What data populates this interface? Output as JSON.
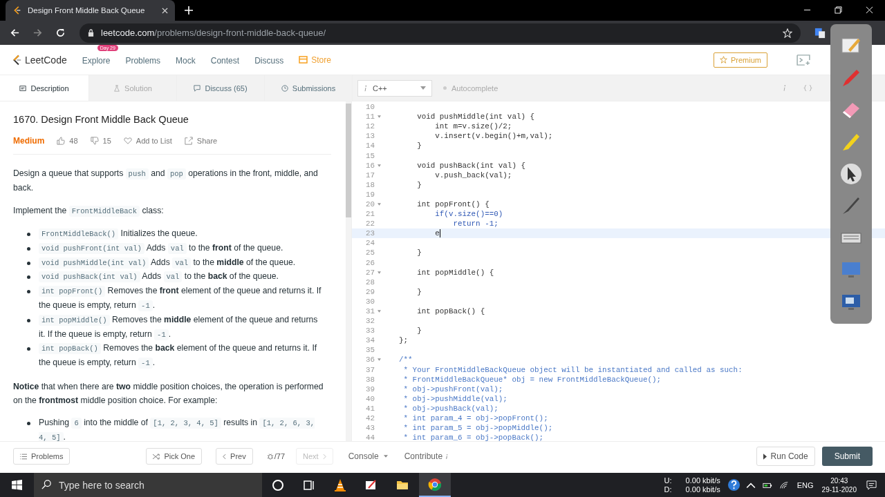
{
  "browser": {
    "tab_title": "Design Front Middle Back Queue",
    "url_host": "leetcode.com",
    "url_path": "/problems/design-front-middle-back-queue/"
  },
  "nav": {
    "logo": "LeetCode",
    "premium": "Premium",
    "items": [
      {
        "label": "Explore",
        "kind": "badge",
        "badge": "Day 29"
      },
      {
        "label": "Problems",
        "kind": "plain"
      },
      {
        "label": "Mock",
        "kind": "plain"
      },
      {
        "label": "Contest",
        "kind": "plain"
      },
      {
        "label": "Discuss",
        "kind": "plain"
      },
      {
        "label": "Store",
        "kind": "store"
      }
    ]
  },
  "panel_tabs": [
    {
      "label": "Description",
      "selected": true,
      "disabled": false
    },
    {
      "label": "Solution",
      "selected": false,
      "disabled": true
    },
    {
      "label": "Discuss (65)",
      "selected": false,
      "disabled": false
    },
    {
      "label": "Submissions",
      "selected": false,
      "disabled": false
    }
  ],
  "editor_toolbar": {
    "language": "C++",
    "autocomplete": "Autocomplete"
  },
  "problem": {
    "title": "1670. Design Front Middle Back Queue",
    "difficulty": "Medium",
    "likes": "48",
    "dislikes": "15",
    "add_to_list": "Add to List",
    "share": "Share",
    "blocks": [
      {
        "kind": "para",
        "segments": [
          {
            "kind": "text",
            "text": "Design a queue that supports "
          },
          {
            "kind": "code",
            "text": "push"
          },
          {
            "kind": "text",
            "text": " and "
          },
          {
            "kind": "code",
            "text": "pop"
          },
          {
            "kind": "text",
            "text": " operations in the front, middle, and back."
          }
        ]
      },
      {
        "kind": "para",
        "segments": [
          {
            "kind": "text",
            "text": "Implement the "
          },
          {
            "kind": "code",
            "text": "FrontMiddleBack"
          },
          {
            "kind": "text",
            "text": " class:"
          }
        ]
      },
      {
        "kind": "list",
        "items": [
          [
            {
              "kind": "code",
              "text": "FrontMiddleBack()"
            },
            {
              "kind": "text",
              "text": " Initializes the queue."
            }
          ],
          [
            {
              "kind": "code",
              "text": "void pushFront(int val)"
            },
            {
              "kind": "text",
              "text": " Adds "
            },
            {
              "kind": "code",
              "text": "val"
            },
            {
              "kind": "text",
              "text": " to the **front** of the queue."
            }
          ],
          [
            {
              "kind": "code",
              "text": "void pushMiddle(int val)"
            },
            {
              "kind": "text",
              "text": " Adds "
            },
            {
              "kind": "code",
              "text": "val"
            },
            {
              "kind": "text",
              "text": " to the **middle** of the queue."
            }
          ],
          [
            {
              "kind": "code",
              "text": "void pushBack(int val)"
            },
            {
              "kind": "text",
              "text": " Adds "
            },
            {
              "kind": "code",
              "text": "val"
            },
            {
              "kind": "text",
              "text": " to the **back** of the queue."
            }
          ],
          [
            {
              "kind": "code",
              "text": "int popFront()"
            },
            {
              "kind": "text",
              "text": " Removes the **front** element of the queue and returns it. If the queue is empty, return "
            },
            {
              "kind": "code",
              "text": "-1"
            },
            {
              "kind": "text",
              "text": "."
            }
          ],
          [
            {
              "kind": "code",
              "text": "int popMiddle()"
            },
            {
              "kind": "text",
              "text": " Removes the **middle** element of the queue and returns it. If the queue is empty, return "
            },
            {
              "kind": "code",
              "text": "-1"
            },
            {
              "kind": "text",
              "text": "."
            }
          ],
          [
            {
              "kind": "code",
              "text": "int popBack()"
            },
            {
              "kind": "text",
              "text": " Removes the **back** element of the queue and returns it. If the queue is empty, return "
            },
            {
              "kind": "code",
              "text": "-1"
            },
            {
              "kind": "text",
              "text": "."
            }
          ]
        ]
      },
      {
        "kind": "para",
        "segments": [
          {
            "kind": "text",
            "text": "**Notice** that when there are **two** middle position choices, the operation is performed on the **frontmost** middle position choice. For example:"
          }
        ]
      },
      {
        "kind": "list",
        "items": [
          [
            {
              "kind": "text",
              "text": "Pushing "
            },
            {
              "kind": "code",
              "text": "6"
            },
            {
              "kind": "text",
              "text": " into the middle of "
            },
            {
              "kind": "code",
              "text": "[1, 2, 3, 4, 5]"
            },
            {
              "kind": "text",
              "text": " results in "
            },
            {
              "kind": "code",
              "text": "[1, 2, 6, 3, 4, 5]"
            },
            {
              "kind": "text",
              "text": "."
            }
          ]
        ]
      }
    ]
  },
  "code_lines": [
    {
      "num": "10",
      "kind": "code",
      "fold": false,
      "active": false
    },
    {
      "num": "11",
      "text": "    void pushMiddle(int val) {",
      "kind": "code",
      "fold": true,
      "active": false
    },
    {
      "num": "12",
      "text": "        int m=v.size()/2;",
      "kind": "code",
      "fold": false,
      "active": false
    },
    {
      "num": "13",
      "text": "        v.insert(v.begin()+m,val);",
      "kind": "code",
      "fold": false,
      "active": false
    },
    {
      "num": "14",
      "text": "    }",
      "kind": "code",
      "fold": false,
      "active": false
    },
    {
      "num": "15",
      "kind": "code",
      "fold": false,
      "active": false
    },
    {
      "num": "16",
      "text": "    void pushBack(int val) {",
      "kind": "code",
      "fold": true,
      "active": false
    },
    {
      "num": "17",
      "text": "        v.push_back(val);",
      "kind": "code",
      "fold": false,
      "active": false
    },
    {
      "num": "18",
      "text": "    }",
      "kind": "code",
      "fold": false,
      "active": false
    },
    {
      "num": "19",
      "kind": "code",
      "fold": false,
      "active": false
    },
    {
      "num": "20",
      "text": "    int popFront() {",
      "kind": "code",
      "fold": true,
      "active": false
    },
    {
      "num": "21",
      "text": "        if(v.size()==0)",
      "kind": "keyword",
      "fold": false,
      "active": false
    },
    {
      "num": "22",
      "text": "            return -1;",
      "kind": "keyword",
      "fold": false,
      "active": false
    },
    {
      "num": "23",
      "text": "        e",
      "kind": "code",
      "fold": false,
      "active": true
    },
    {
      "num": "24",
      "kind": "code",
      "fold": false,
      "active": false
    },
    {
      "num": "25",
      "text": "    }",
      "kind": "code",
      "fold": false,
      "active": false
    },
    {
      "num": "26",
      "kind": "code",
      "fold": false,
      "active": false
    },
    {
      "num": "27",
      "text": "    int popMiddle() {",
      "kind": "code",
      "fold": true,
      "active": false
    },
    {
      "num": "28",
      "kind": "code",
      "fold": false,
      "active": false
    },
    {
      "num": "29",
      "text": "    }",
      "kind": "code",
      "fold": false,
      "active": false
    },
    {
      "num": "30",
      "kind": "code",
      "fold": false,
      "active": false
    },
    {
      "num": "31",
      "text": "    int popBack() {",
      "kind": "code",
      "fold": true,
      "active": false
    },
    {
      "num": "32",
      "kind": "code",
      "fold": false,
      "active": false
    },
    {
      "num": "33",
      "text": "    }",
      "kind": "code",
      "fold": false,
      "active": false
    },
    {
      "num": "34",
      "text": "};",
      "kind": "code",
      "fold": false,
      "active": false
    },
    {
      "num": "35",
      "kind": "code",
      "fold": false,
      "active": false
    },
    {
      "num": "36",
      "text": "/**",
      "kind": "comment",
      "fold": true,
      "active": false
    },
    {
      "num": "37",
      "text": " * Your FrontMiddleBackQueue object will be instantiated and called as such:",
      "kind": "comment",
      "fold": false,
      "active": false
    },
    {
      "num": "38",
      "text": " * FrontMiddleBackQueue* obj = new FrontMiddleBackQueue();",
      "kind": "comment",
      "fold": false,
      "active": false
    },
    {
      "num": "39",
      "text": " * obj->pushFront(val);",
      "kind": "comment",
      "fold": false,
      "active": false
    },
    {
      "num": "40",
      "text": " * obj->pushMiddle(val);",
      "kind": "comment",
      "fold": false,
      "active": false
    },
    {
      "num": "41",
      "text": " * obj->pushBack(val);",
      "kind": "comment",
      "fold": false,
      "active": false
    },
    {
      "num": "42",
      "text": " * int param_4 = obj->popFront();",
      "kind": "comment",
      "fold": false,
      "active": false
    },
    {
      "num": "43",
      "text": " * int param_5 = obj->popMiddle();",
      "kind": "comment",
      "fold": false,
      "active": false
    },
    {
      "num": "44",
      "text": " * int param_6 = obj->popBack();",
      "kind": "comment",
      "fold": false,
      "active": false
    }
  ],
  "footer": {
    "problems": "Problems",
    "pick_one": "Pick One",
    "prev": "Prev",
    "page": "/77",
    "next": "Next",
    "next_disabled": true,
    "console": "Console",
    "contribute": "Contribute",
    "run": "Run Code",
    "submit": "Submit"
  },
  "taskbar": {
    "search_placeholder": "Type here to search",
    "upload_label": "U:",
    "download_label": "D:",
    "upload": "0.00 kbit/s",
    "download": "0.00 kbit/s",
    "language": "ENG",
    "time": "20:43",
    "date": "29-11-2020"
  }
}
